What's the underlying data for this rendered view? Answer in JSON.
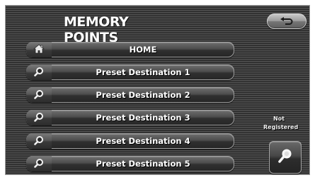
{
  "header": {
    "title": "MEMORY POINTS",
    "back_icon": "return-arrow-icon"
  },
  "menu": {
    "items": [
      {
        "label": "HOME",
        "icon": "home-icon"
      },
      {
        "label": "Preset Destination 1",
        "icon": "magnifier-icon"
      },
      {
        "label": "Preset Destination 2",
        "icon": "magnifier-icon"
      },
      {
        "label": "Preset Destination 3",
        "icon": "magnifier-icon"
      },
      {
        "label": "Preset Destination 4",
        "icon": "magnifier-icon"
      },
      {
        "label": "Preset Destination 5",
        "icon": "magnifier-icon"
      }
    ]
  },
  "side_panel": {
    "status_line1": "Not",
    "status_line2": "Registered",
    "search_icon": "magnifier-icon"
  },
  "colors": {
    "background": "#2e2e2e",
    "text": "#ffffff",
    "button_border": "#9f9f9f"
  }
}
